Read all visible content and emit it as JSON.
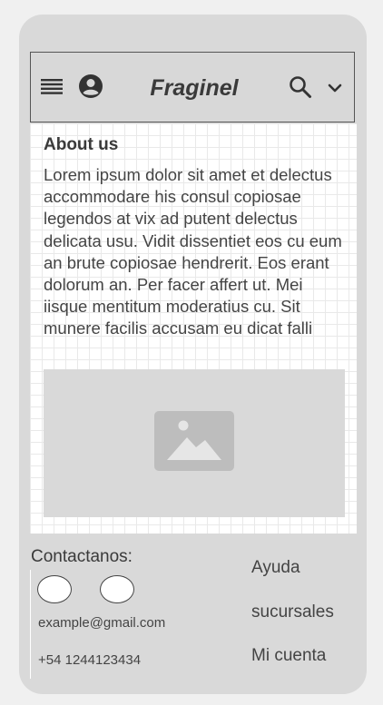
{
  "header": {
    "brand": "Fraginel",
    "icons": {
      "menu": "menu-icon",
      "account": "account-circle-icon",
      "search": "search-icon",
      "dropdown": "chevron-down-icon"
    }
  },
  "about": {
    "title": "About us",
    "body": "Lorem ipsum dolor sit amet et delectus accommodare his consul copiosae legendos at vix ad putent delectus delicata usu. Vidit dissentiet eos cu eum an brute copiosae hendrerit. Eos erant dolorum an. Per facer affert ut. Mei iisque mentitum moderatius cu. Sit munere facilis accusam eu dicat falli"
  },
  "image_placeholder": {
    "icon": "image-icon"
  },
  "footer": {
    "contact_title": "Contactanos:",
    "email": "example@gmail.com",
    "phone": "+54 1244123434",
    "links": [
      "Ayuda",
      "sucursales",
      "Mi cuenta"
    ]
  },
  "colors": {
    "frame": "#d9d9d9",
    "text": "#3a3a3a",
    "page_bg": "#f0f0f0"
  }
}
